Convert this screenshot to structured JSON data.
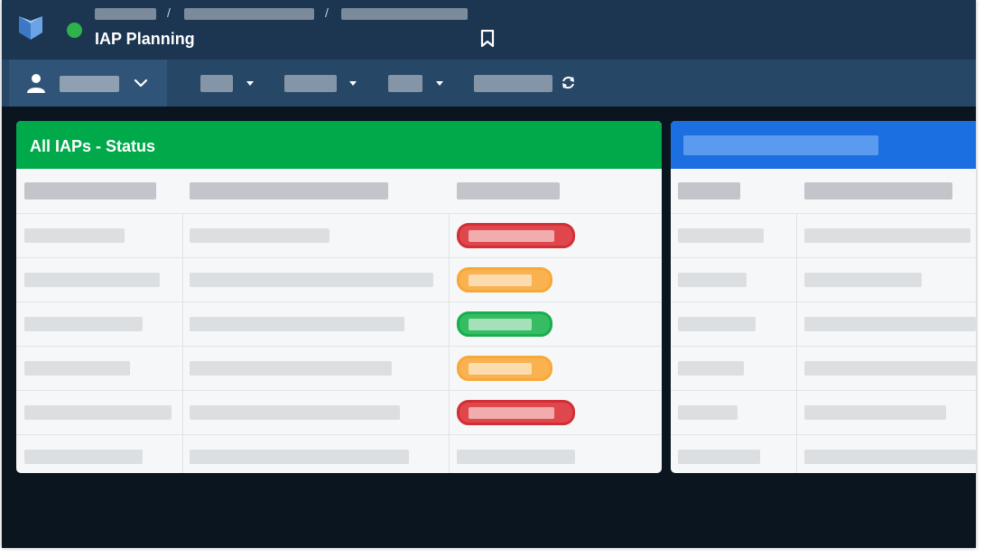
{
  "header": {
    "title": "IAP Planning",
    "status_color": "#2eb34a",
    "breadcrumb_separator": "/",
    "icons": [
      "app-logo-icon",
      "bookmark-icon"
    ]
  },
  "toolbar": {
    "icons": [
      "user-icon",
      "chevron-down-icon",
      "caret-down-icon",
      "refresh-icon"
    ]
  },
  "panels": {
    "left": {
      "title": "All IAPs - Status",
      "header_color": "#00a94a",
      "status_pills": [
        "red",
        "orange",
        "green",
        "orange",
        "red"
      ]
    },
    "right": {
      "header_color": "#1b6fe0"
    }
  },
  "colors": {
    "status_red": "#e0474d",
    "status_orange": "#f9b24f",
    "status_green": "#36bd63"
  }
}
